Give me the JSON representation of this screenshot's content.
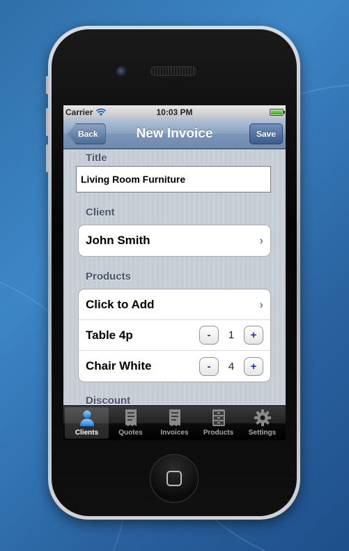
{
  "status_bar": {
    "carrier": "Carrier",
    "time": "10:03 PM",
    "battery_level": 1.0
  },
  "nav": {
    "back_label": "Back",
    "title": "New Invoice",
    "save_label": "Save"
  },
  "form": {
    "title_label": "Title",
    "title_value": "Living Room Furniture",
    "client_label": "Client",
    "client_value": "John Smith",
    "products_label": "Products",
    "add_product_label": "Click to Add",
    "products": [
      {
        "name": "Table 4p",
        "quantity": "1",
        "minus": "-",
        "plus": "+"
      },
      {
        "name": "Chair White",
        "quantity": "4",
        "minus": "-",
        "plus": "+"
      }
    ],
    "next_section_label": "Discount"
  },
  "tabs": [
    {
      "label": "Clients",
      "icon": "person-icon",
      "active": true
    },
    {
      "label": "Quotes",
      "icon": "receipt-icon",
      "active": false
    },
    {
      "label": "Invoices",
      "icon": "receipt-icon",
      "active": false
    },
    {
      "label": "Products",
      "icon": "cabinet-icon",
      "active": false
    },
    {
      "label": "Settings",
      "icon": "gear-icon",
      "active": false
    }
  ],
  "colors": {
    "nav_bar": "#7b96b7",
    "stepper_text": "#1b2fd0",
    "section_label": "#4c566c",
    "active_tab_icon": "#3ea0e6"
  }
}
